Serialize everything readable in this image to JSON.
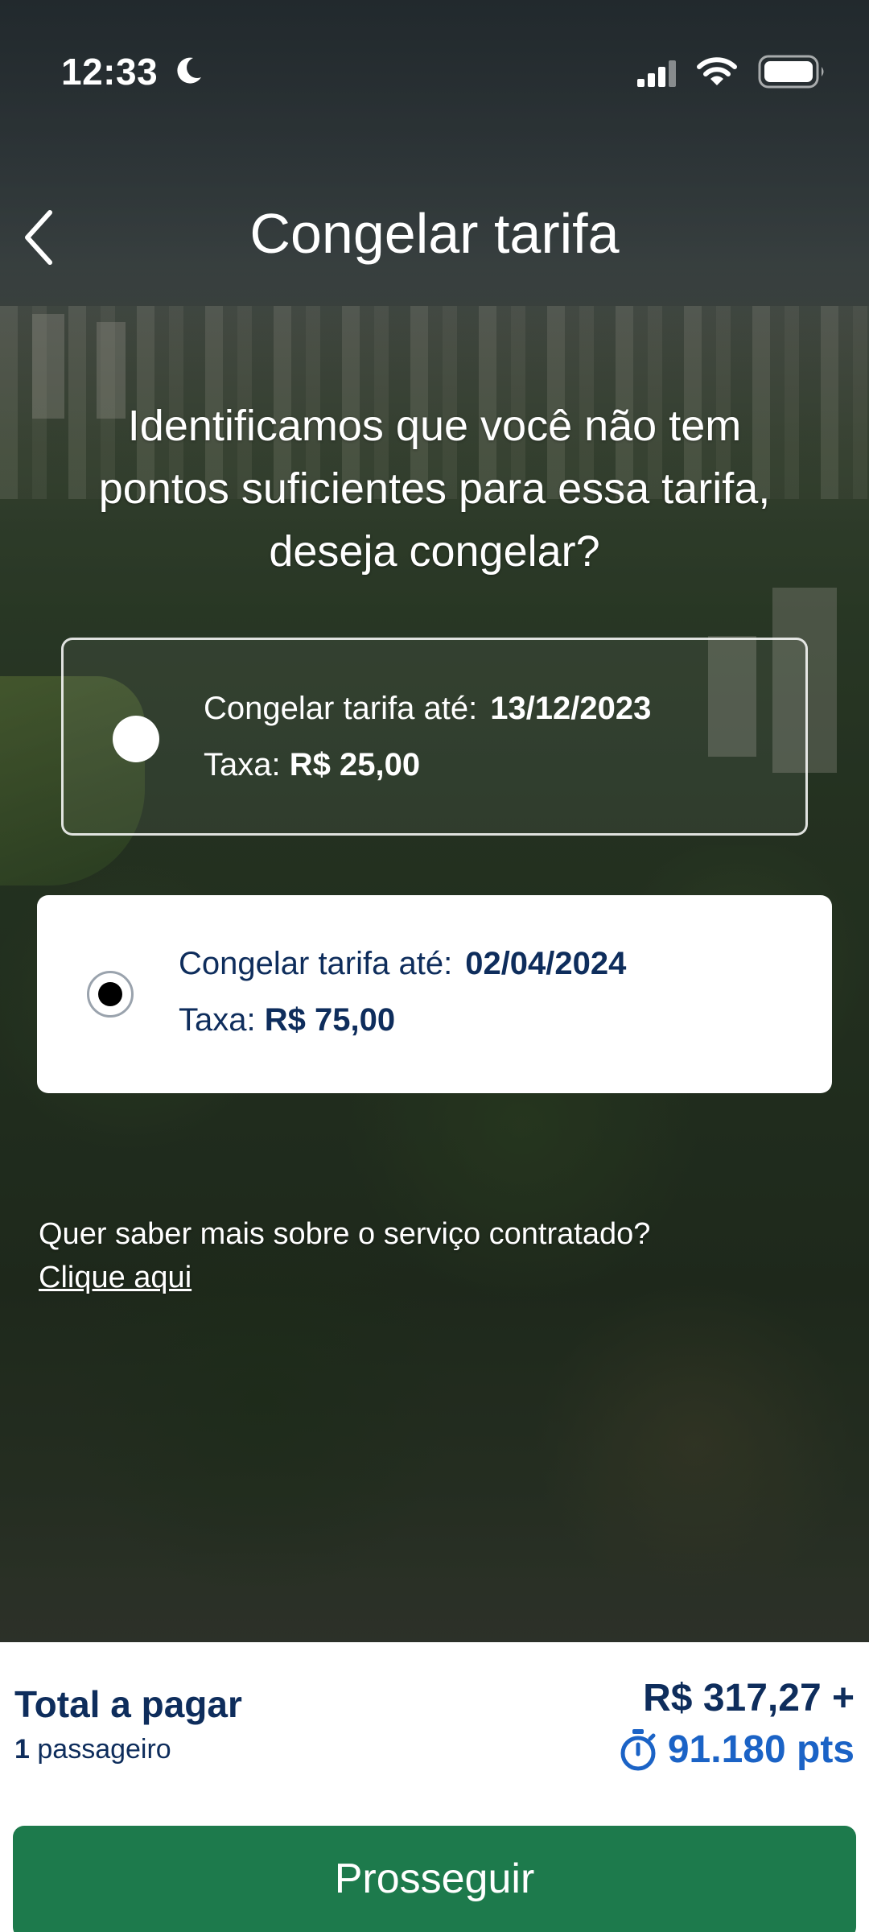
{
  "status_bar": {
    "time": "12:33",
    "icons": [
      "moon-icon",
      "cellular-signal-icon",
      "wifi-icon",
      "battery-icon"
    ]
  },
  "header": {
    "title": "Congelar tarifa",
    "back_icon": "chevron-left-icon"
  },
  "intro": {
    "line1": "Identificamos que você não tem",
    "line2": "pontos suficientes para essa tarifa,",
    "line3": "deseja congelar?"
  },
  "options": [
    {
      "freeze_label": "Congelar tarifa até:",
      "date": "13/12/2023",
      "fee_label": "Taxa:",
      "fee": "R$ 25,00",
      "selected": false
    },
    {
      "freeze_label": "Congelar tarifa até:",
      "date": "02/04/2024",
      "fee_label": "Taxa:",
      "fee": "R$ 75,00",
      "selected": true
    }
  ],
  "info": {
    "question": "Quer saber mais sobre o serviço contratado?",
    "link": "Clique aqui"
  },
  "footer": {
    "total_label": "Total a pagar",
    "passenger_count": "1",
    "passenger_label": "passageiro",
    "price_cash": "R$ 317,27 +",
    "price_points": "91.180 pts",
    "points_icon": "stopwatch-icon",
    "continue_label": "Prosseguir"
  },
  "colors": {
    "navy_text": "#0e2d5c",
    "points_blue": "#1b63c6",
    "button_green": "#1d7a4c"
  }
}
